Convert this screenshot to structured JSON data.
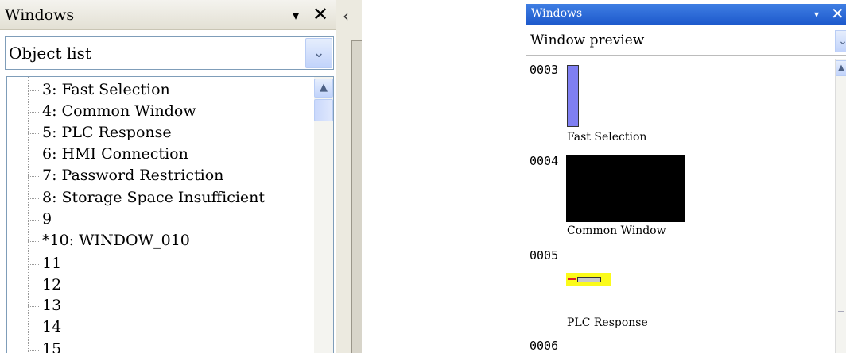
{
  "left_panel": {
    "title": "Windows",
    "pin_glyph": "▾",
    "close_glyph": "✕",
    "nav_glyph": "‹",
    "dropdown_value": "Object list",
    "dropdown_arrow": "⌄",
    "scroll_up": "▲",
    "tree_items": [
      "3: Fast Selection",
      "4: Common Window",
      "5: PLC Response",
      "6: HMI Connection",
      "7: Password Restriction",
      "8: Storage Space Insufficient",
      "9",
      "*10: WINDOW_010",
      "11",
      "12",
      "13",
      "14",
      "15"
    ]
  },
  "right_panel": {
    "title": "Windows",
    "pin_glyph": "▾",
    "close_glyph": "✕",
    "dropdown_value": "Window preview",
    "dropdown_arrow": "⌄",
    "scroll_up": "▲",
    "previews": [
      {
        "number": "0003",
        "label": "Fast Selection",
        "thumb_color": "#7f7ff2"
      },
      {
        "number": "0004",
        "label": "Common Window",
        "thumb_color": "#000000"
      },
      {
        "number": "0005",
        "label": "PLC Response",
        "thumb_color": "#fbfb1a"
      },
      {
        "number": "0006",
        "label": ""
      }
    ]
  }
}
